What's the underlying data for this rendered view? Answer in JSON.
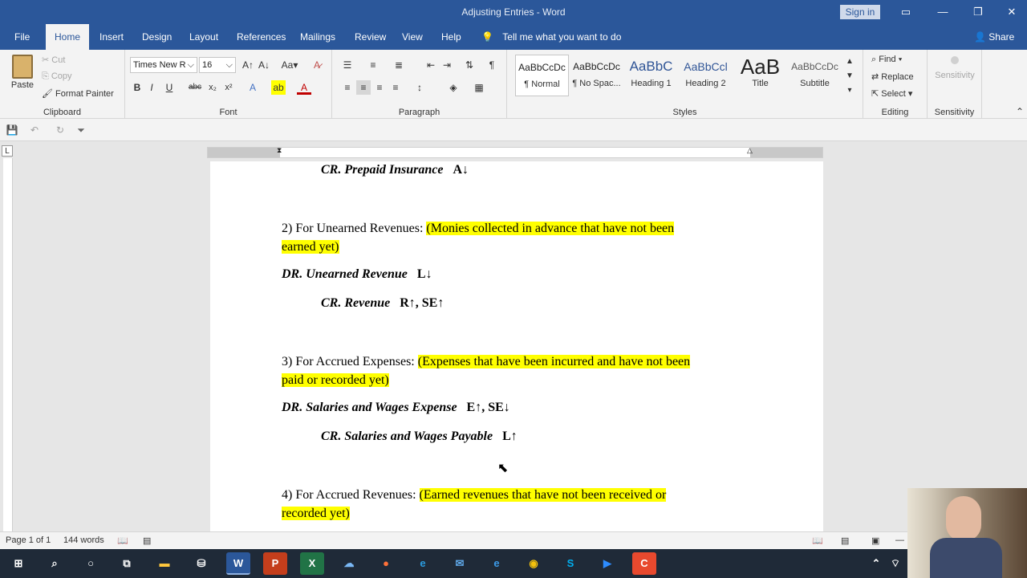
{
  "window": {
    "title": "Adjusting Entries - Word",
    "sign_in": "Sign in"
  },
  "tabs": [
    {
      "label": "File"
    },
    {
      "label": "Home"
    },
    {
      "label": "Insert"
    },
    {
      "label": "Design"
    },
    {
      "label": "Layout"
    },
    {
      "label": "References"
    },
    {
      "label": "Mailings"
    },
    {
      "label": "Review"
    },
    {
      "label": "View"
    },
    {
      "label": "Help"
    }
  ],
  "tell_me": "Tell me what you want to do",
  "share": "Share",
  "ribbon": {
    "clipboard": {
      "paste": "Paste",
      "cut": "Cut",
      "copy": "Copy",
      "format_painter": "Format Painter",
      "label": "Clipboard"
    },
    "font": {
      "name": "Times New R",
      "size": "16",
      "label": "Font"
    },
    "paragraph": {
      "label": "Paragraph"
    },
    "styles": {
      "items": [
        {
          "preview": "AaBbCcDc",
          "name": "¶ Normal"
        },
        {
          "preview": "AaBbCcDc",
          "name": "¶ No Spac..."
        },
        {
          "preview": "AaBbC",
          "name": "Heading 1"
        },
        {
          "preview": "AaBbCcl",
          "name": "Heading 2"
        },
        {
          "preview": "AaB",
          "name": "Title"
        },
        {
          "preview": "AaBbCcDc",
          "name": "Subtitle"
        }
      ],
      "label": "Styles"
    },
    "editing": {
      "find": "Find",
      "replace": "Replace",
      "select": "Select",
      "label": "Editing"
    },
    "sensitivity": {
      "button": "Sensitivity",
      "label": "Sensitivity"
    }
  },
  "document": {
    "line_prepaid_cr": {
      "entry": "CR. Prepaid Insurance",
      "effect": "A↓"
    },
    "p2": {
      "text": "2) For Unearned Revenues: ",
      "hl1": "(Monies collected in advance that have not been",
      "hl2": "earned yet)"
    },
    "p2_dr": {
      "entry": "DR. Unearned Revenue",
      "effect": "L↓"
    },
    "p2_cr": {
      "entry": "CR. Revenue",
      "effect": "R↑, SE↑"
    },
    "p3": {
      "text": "3) For Accrued Expenses: ",
      "hl1": "(Expenses that have been incurred and have not been",
      "hl2": "paid or recorded yet)"
    },
    "p3_dr": {
      "entry": "DR. Salaries and Wages Expense",
      "effect": "E↑, SE↓"
    },
    "p3_cr": {
      "entry": "CR. Salaries and Wages Payable",
      "effect": "L↑"
    },
    "p4": {
      "text": "4) For Accrued Revenues: ",
      "hl1": "(Earned revenues that have not been received or",
      "hl2": "recorded yet)"
    }
  },
  "status": {
    "page": "Page 1 of 1",
    "words": "144 words"
  },
  "colors": {
    "accent": "#2b579a",
    "highlight": "#ffff00"
  }
}
